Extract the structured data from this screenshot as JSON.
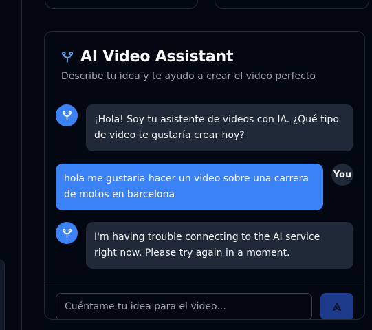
{
  "assistant": {
    "title": "AI Video Assistant",
    "subtitle": "Describe tu idea y te ayudo a crear el video perfecto",
    "icon": "ai-branch-icon"
  },
  "messages": [
    {
      "role": "ai",
      "text": "¡Hola! Soy tu asistente de videos con IA. ¿Qué tipo de video te gustaría crear hoy?"
    },
    {
      "role": "user",
      "text": "hola me gustaria hacer un video sobre una carrera de motos en barcelona",
      "avatar_label": "You"
    },
    {
      "role": "ai",
      "text": "I'm having trouble connecting to the AI service right now. Please try again in a moment."
    }
  ],
  "input": {
    "placeholder": "Cuéntame tu idea para el video...",
    "value": ""
  },
  "send_button": {
    "icon": "send-icon"
  },
  "colors": {
    "background": "#030712",
    "card_border": "#1f2937",
    "ai_bubble": "#1f2937",
    "user_bubble": "#3b82f6",
    "accent": "#3b82f6",
    "send_button": "#1e3a8a",
    "subtitle": "#9ca3af"
  }
}
